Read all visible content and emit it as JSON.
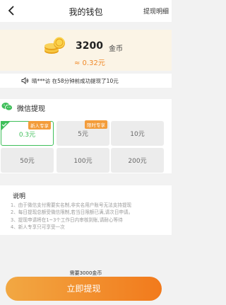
{
  "header": {
    "title": "我的钱包",
    "right_link": "提现明细"
  },
  "balance": {
    "amount": "3200",
    "unit": "金币",
    "approx": "≈ 0.32元"
  },
  "notice": {
    "text": "晴***访 在58分钟前成功提现了10元"
  },
  "withdraw": {
    "title": "微信提现",
    "options": [
      {
        "label": "0.3元",
        "tag": "新人专享",
        "selected": true
      },
      {
        "label": "5元",
        "tag": "限时专享",
        "selected": false
      },
      {
        "label": "10元",
        "tag": "",
        "selected": false
      },
      {
        "label": "50元",
        "tag": "",
        "selected": false
      },
      {
        "label": "100元",
        "tag": "",
        "selected": false
      },
      {
        "label": "200元",
        "tag": "",
        "selected": false
      }
    ]
  },
  "description": {
    "title": "说明",
    "rules": [
      "1、由于微信支付需要实名制,非实名用户账号无法支持提现",
      "2、每日提现总额受微信限制,若当日限额已满,请次日申请。",
      "3、提现申请将在1~3个工作日内审核到账,请耐心等待",
      "4、新人专享只可享受一次"
    ]
  },
  "footer": {
    "need_text": "需要3000金币",
    "button_label": "立即提现"
  },
  "colors": {
    "accent_orange": "#f08a2a",
    "wechat_green": "#3fbf5a",
    "card_bg": "#fbf4e6"
  }
}
